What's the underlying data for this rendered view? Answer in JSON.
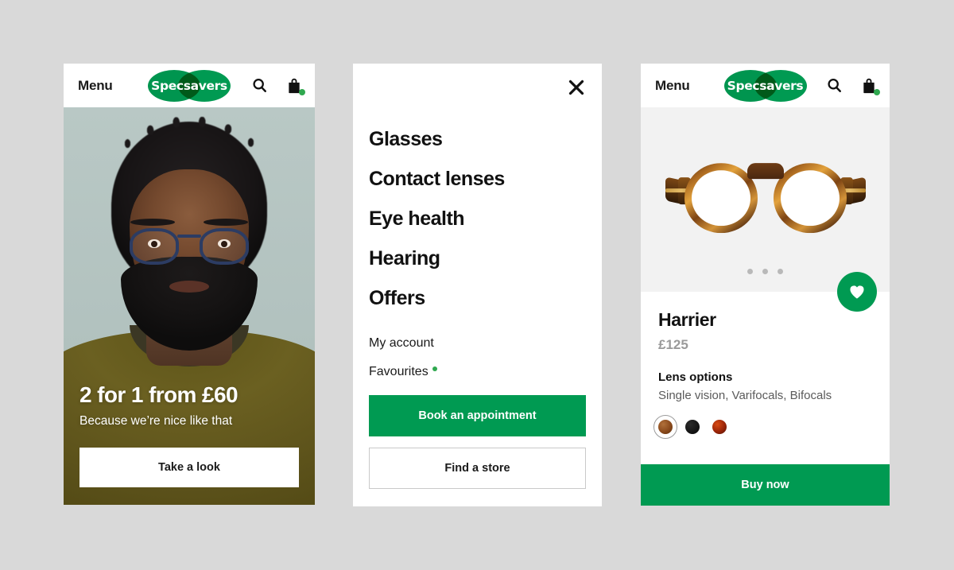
{
  "background_color": "#d9d9d9",
  "brand": {
    "name": "Specsavers",
    "green": "#009a52",
    "dot_green": "#2fa84f"
  },
  "home_screen": {
    "appbar": {
      "menu_label": "Menu",
      "logo_text": "Specsavers",
      "search_icon": "search-icon",
      "bag_icon": "shopping-bag-icon"
    },
    "hero": {
      "title": "2 for 1 from £60",
      "subtitle": "Because we’re nice like that",
      "cta_label": "Take a look",
      "image_alt": "Man with dark curly hair, beard and blue glasses wearing an olive t-shirt"
    }
  },
  "menu_screen": {
    "close_icon": "close-icon",
    "primary_items": [
      {
        "label": "Glasses"
      },
      {
        "label": "Contact lenses"
      },
      {
        "label": "Eye health"
      },
      {
        "label": "Hearing"
      },
      {
        "label": "Offers"
      }
    ],
    "secondary_items": [
      {
        "label": "My account",
        "has_dot": false
      },
      {
        "label": "Favourites",
        "has_dot": true
      }
    ],
    "primary_cta": "Book an appointment",
    "secondary_cta": "Find a store"
  },
  "product_screen": {
    "appbar": {
      "menu_label": "Menu",
      "logo_text": "Specsavers",
      "search_icon": "search-icon",
      "bag_icon": "shopping-bag-icon"
    },
    "media": {
      "image_alt": "Round tortoiseshell glasses with gold bridge bar",
      "carousel_dots": 3,
      "active_dot_index": 0,
      "favourite_icon": "heart-icon"
    },
    "name": "Harrier",
    "price": "£125",
    "lens_options_label": "Lens options",
    "lens_options_values": "Single vision, Varifocals, Bifocals",
    "colour_swatches": [
      {
        "name": "brown-tortoiseshell",
        "hex": "#8a4a1c",
        "selected": true
      },
      {
        "name": "black",
        "hex": "#111111",
        "selected": false
      },
      {
        "name": "red-tortoiseshell",
        "hex": "#9a2408",
        "selected": false
      }
    ],
    "buy_label": "Buy now"
  }
}
